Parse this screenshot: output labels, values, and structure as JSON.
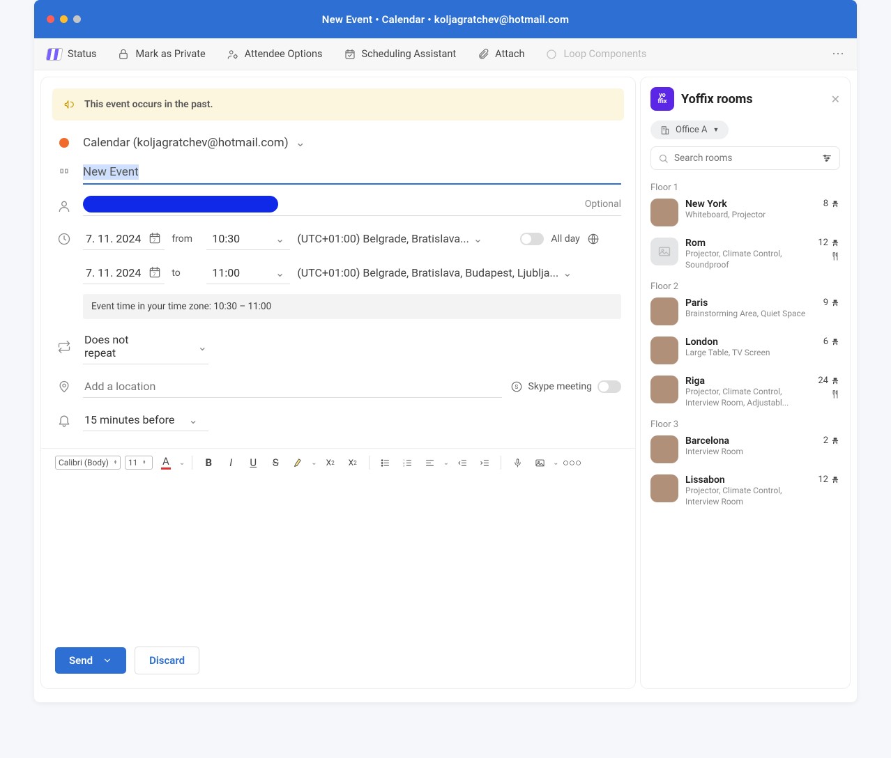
{
  "window_title": "New Event • Calendar • koljagratchev@hotmail.com",
  "ribbon": {
    "status": "Status",
    "private": "Mark as Private",
    "attendee": "Attendee Options",
    "scheduling": "Scheduling Assistant",
    "attach": "Attach",
    "loop": "Loop Components"
  },
  "notice": "This event occurs in the past.",
  "calendar_select": "Calendar (koljagratchev@hotmail.com)",
  "event_title": "New Event",
  "optional_label": "Optional",
  "date_start": "7. 11. 2024",
  "from_label": "from",
  "time_start": "10:30",
  "tz1": "(UTC+01:00) Belgrade, Bratislava...",
  "allday_label": "All day",
  "date_end": "7. 11. 2024",
  "to_label": "to",
  "time_end": "11:00",
  "tz2": "(UTC+01:00) Belgrade, Bratislava, Budapest, Ljublja...",
  "tz_strip": "Event time in your time zone: 10:30 – 11:00",
  "repeat": "Does not repeat",
  "location_placeholder": "Add a location",
  "skype_label": "Skype meeting",
  "reminder": "15 minutes before",
  "font_family": "Calibri (Body)",
  "font_size": "11",
  "send_label": "Send",
  "discard_label": "Discard",
  "side": {
    "title": "Yoffix rooms",
    "building": "Office A",
    "search_placeholder": "Search rooms",
    "floors": [
      {
        "label": "Floor 1",
        "rooms": [
          {
            "name": "New York",
            "meta": "Whiteboard, Projector",
            "cap": "8",
            "grey": false,
            "cater": false
          },
          {
            "name": "Rom",
            "meta": "Projector, Climate Control, Soundproof",
            "cap": "12",
            "grey": true,
            "cater": true
          }
        ]
      },
      {
        "label": "Floor 2",
        "rooms": [
          {
            "name": "Paris",
            "meta": "Brainstorming Area, Quiet Space",
            "cap": "9",
            "grey": false,
            "cater": false
          },
          {
            "name": "London",
            "meta": "Large Table, TV Screen",
            "cap": "6",
            "grey": false,
            "cater": false
          },
          {
            "name": "Riga",
            "meta": "Projector, Climate Control, Interview Room, Adjustabl...",
            "cap": "24",
            "grey": false,
            "cater": true
          }
        ]
      },
      {
        "label": "Floor 3",
        "rooms": [
          {
            "name": "Barcelona",
            "meta": "Interview Room",
            "cap": "2",
            "grey": false,
            "cater": false
          },
          {
            "name": "Lissabon",
            "meta": "Projector, Climate Control, Interview Room",
            "cap": "12",
            "grey": false,
            "cater": false
          }
        ]
      }
    ]
  }
}
